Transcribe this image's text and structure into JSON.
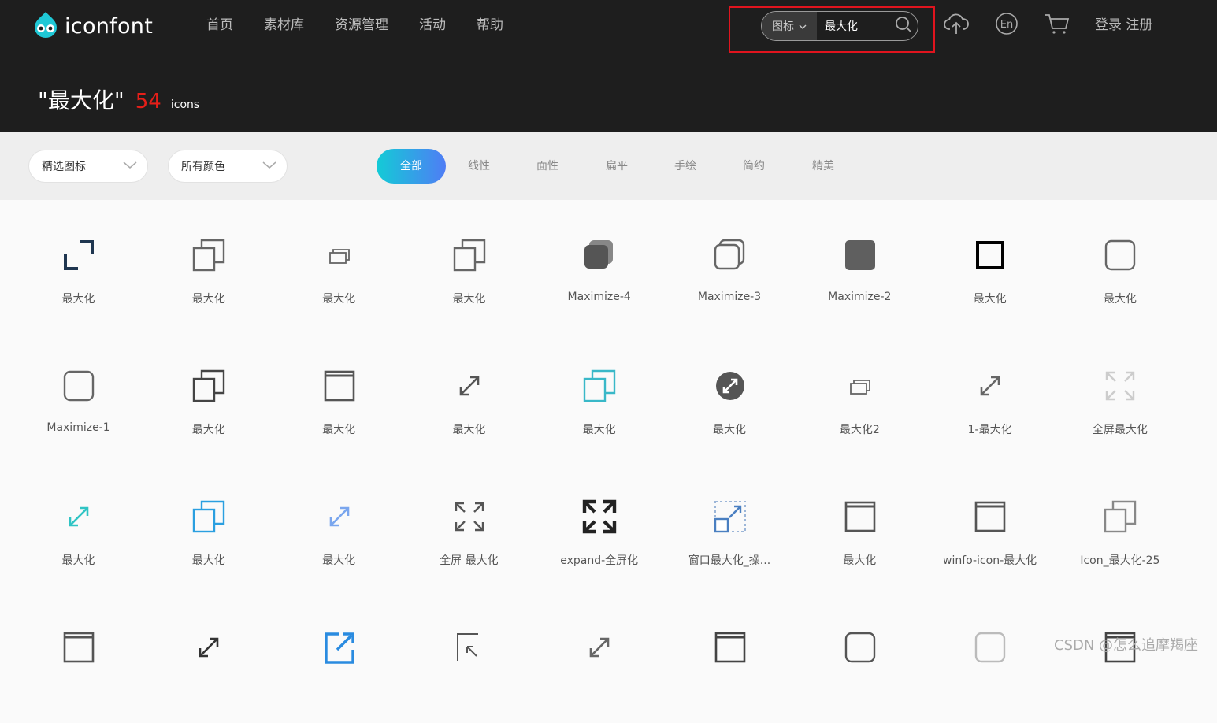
{
  "header": {
    "logo_text": "iconfont",
    "nav": [
      "首页",
      "素材库",
      "资源管理",
      "活动",
      "帮助"
    ],
    "search": {
      "type_label": "图标",
      "value": "最大化"
    },
    "auth": {
      "login": "登录",
      "register": "注册"
    },
    "result": {
      "query": "\"最大化\"",
      "count": "54",
      "unit": "icons"
    },
    "lang_label": "En"
  },
  "filters": {
    "icon_set": "精选图标",
    "color": "所有颜色",
    "style_tabs": [
      "全部",
      "线性",
      "面性",
      "扁平",
      "手绘",
      "简约",
      "精美"
    ],
    "active_tab": "全部"
  },
  "icons": [
    {
      "label": "最大化",
      "icon": "expand-corners-icon",
      "color": "#1f3650"
    },
    {
      "label": "最大化",
      "icon": "restore-window-icon",
      "color": "#666666"
    },
    {
      "label": "最大化",
      "icon": "small-restore-window-icon",
      "color": "#666666"
    },
    {
      "label": "最大化",
      "icon": "restore-window-icon",
      "color": "#666666"
    },
    {
      "label": "Maximize-4",
      "icon": "filled-stacked-square-icon",
      "color": "#555555"
    },
    {
      "label": "Maximize-3",
      "icon": "rounded-stacked-square-icon",
      "color": "#666666"
    },
    {
      "label": "Maximize-2",
      "icon": "filled-rounded-square-icon",
      "color": "#5f5f5f"
    },
    {
      "label": "最大化",
      "icon": "bold-square-icon",
      "color": "#000000"
    },
    {
      "label": "最大化",
      "icon": "rounded-square-icon",
      "color": "#666666"
    },
    {
      "label": "Maximize-1",
      "icon": "rounded-square-icon",
      "color": "#666666"
    },
    {
      "label": "最大化",
      "icon": "restore-window-icon",
      "color": "#444444"
    },
    {
      "label": "最大化",
      "icon": "window-frame-icon",
      "color": "#555555"
    },
    {
      "label": "最大化",
      "icon": "diagonal-arrows-icon",
      "color": "#555555"
    },
    {
      "label": "最大化",
      "icon": "restore-window-icon",
      "color": "#39b8c8"
    },
    {
      "label": "最大化",
      "icon": "circle-expand-icon",
      "color": "#555555"
    },
    {
      "label": "最大化2",
      "icon": "small-restore-window-icon",
      "color": "#666666"
    },
    {
      "label": "1-最大化",
      "icon": "diagonal-arrows-icon",
      "color": "#666666"
    },
    {
      "label": "全屏最大化",
      "icon": "fullscreen-arrows-icon",
      "color": "#cccccc"
    },
    {
      "label": "最大化",
      "icon": "diagonal-arrows-icon",
      "color": "#2fc4c4"
    },
    {
      "label": "最大化",
      "icon": "restore-window-icon",
      "color": "#2a9fe0"
    },
    {
      "label": "最大化",
      "icon": "diagonal-arrows-icon",
      "color": "#7aa6ee"
    },
    {
      "label": "全屏 最大化",
      "icon": "fullscreen-arrows-icon",
      "color": "#555555"
    },
    {
      "label": "expand-全屏化",
      "icon": "bold-fullscreen-arrows-icon",
      "color": "#222222"
    },
    {
      "label": "窗口最大化_操...",
      "icon": "dashed-expand-icon",
      "color": "#4a7fc1"
    },
    {
      "label": "最大化",
      "icon": "window-frame-icon",
      "color": "#555555"
    },
    {
      "label": "winfo-icon-最大化",
      "icon": "window-frame-icon",
      "color": "#555555"
    },
    {
      "label": "Icon_最大化-25",
      "icon": "restore-window-icon",
      "color": "#888888"
    },
    {
      "label": "",
      "icon": "window-frame-icon",
      "color": "#555555"
    },
    {
      "label": "",
      "icon": "diagonal-arrows-icon",
      "color": "#333333"
    },
    {
      "label": "",
      "icon": "share-expand-icon",
      "color": "#2a8be0"
    },
    {
      "label": "",
      "icon": "cursor-square-icon",
      "color": "#555555"
    },
    {
      "label": "",
      "icon": "diagonal-arrows-icon",
      "color": "#666666"
    },
    {
      "label": "",
      "icon": "window-frame-icon",
      "color": "#444444"
    },
    {
      "label": "",
      "icon": "rounded-square-icon",
      "color": "#555555"
    },
    {
      "label": "",
      "icon": "rounded-square-icon",
      "color": "#bbbbbb"
    },
    {
      "label": "",
      "icon": "window-frame-icon",
      "color": "#444444"
    }
  ],
  "watermark": "CSDN @怎么追摩羯座"
}
